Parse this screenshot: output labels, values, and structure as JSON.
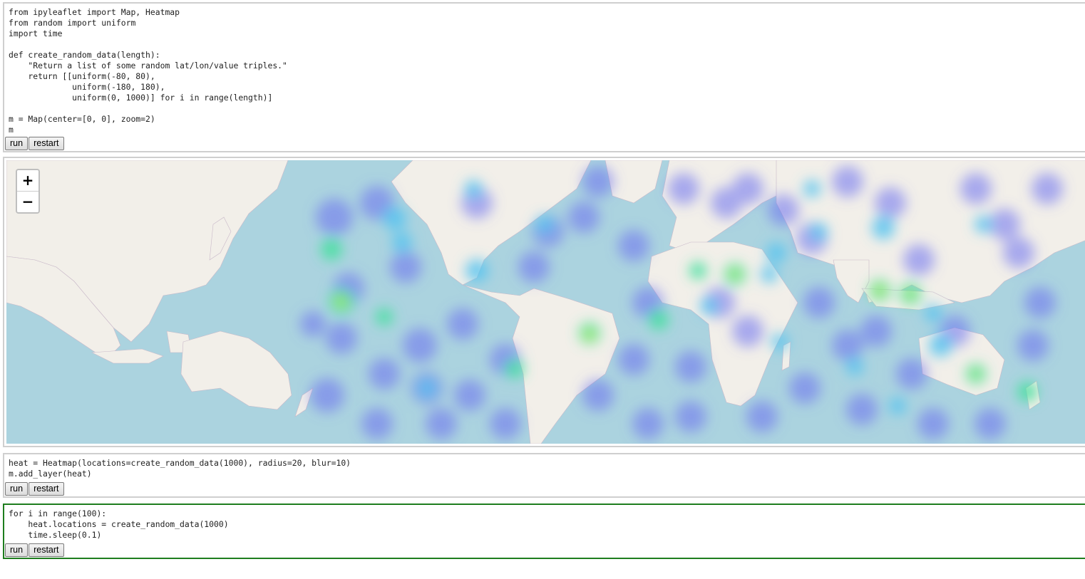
{
  "cells": {
    "c1_lines": [
      "from ipyleaflet import Map, Heatmap",
      "from random import uniform",
      "import time",
      "",
      "def create_random_data(length):",
      "    \"Return a list of some random lat/lon/value triples.\"",
      "    return [[uniform(-80, 80),",
      "             uniform(-180, 180),",
      "             uniform(0, 1000)] for i in range(length)]",
      "",
      "m = Map(center=[0, 0], zoom=2)",
      "m"
    ],
    "c2_lines": [
      "heat = Heatmap(locations=create_random_data(1000), radius=20, blur=10)",
      "m.add_layer(heat)"
    ],
    "c3_lines": [
      "for i in range(100):",
      "    heat.locations = create_random_data(1000)",
      "    time.sleep(0.1)"
    ]
  },
  "buttons": {
    "run": "run",
    "restart": "restart"
  },
  "map": {
    "zoom_in": "+",
    "zoom_out": "−",
    "ocean_color": "#abd3df",
    "land_color": "#f2efe9"
  }
}
